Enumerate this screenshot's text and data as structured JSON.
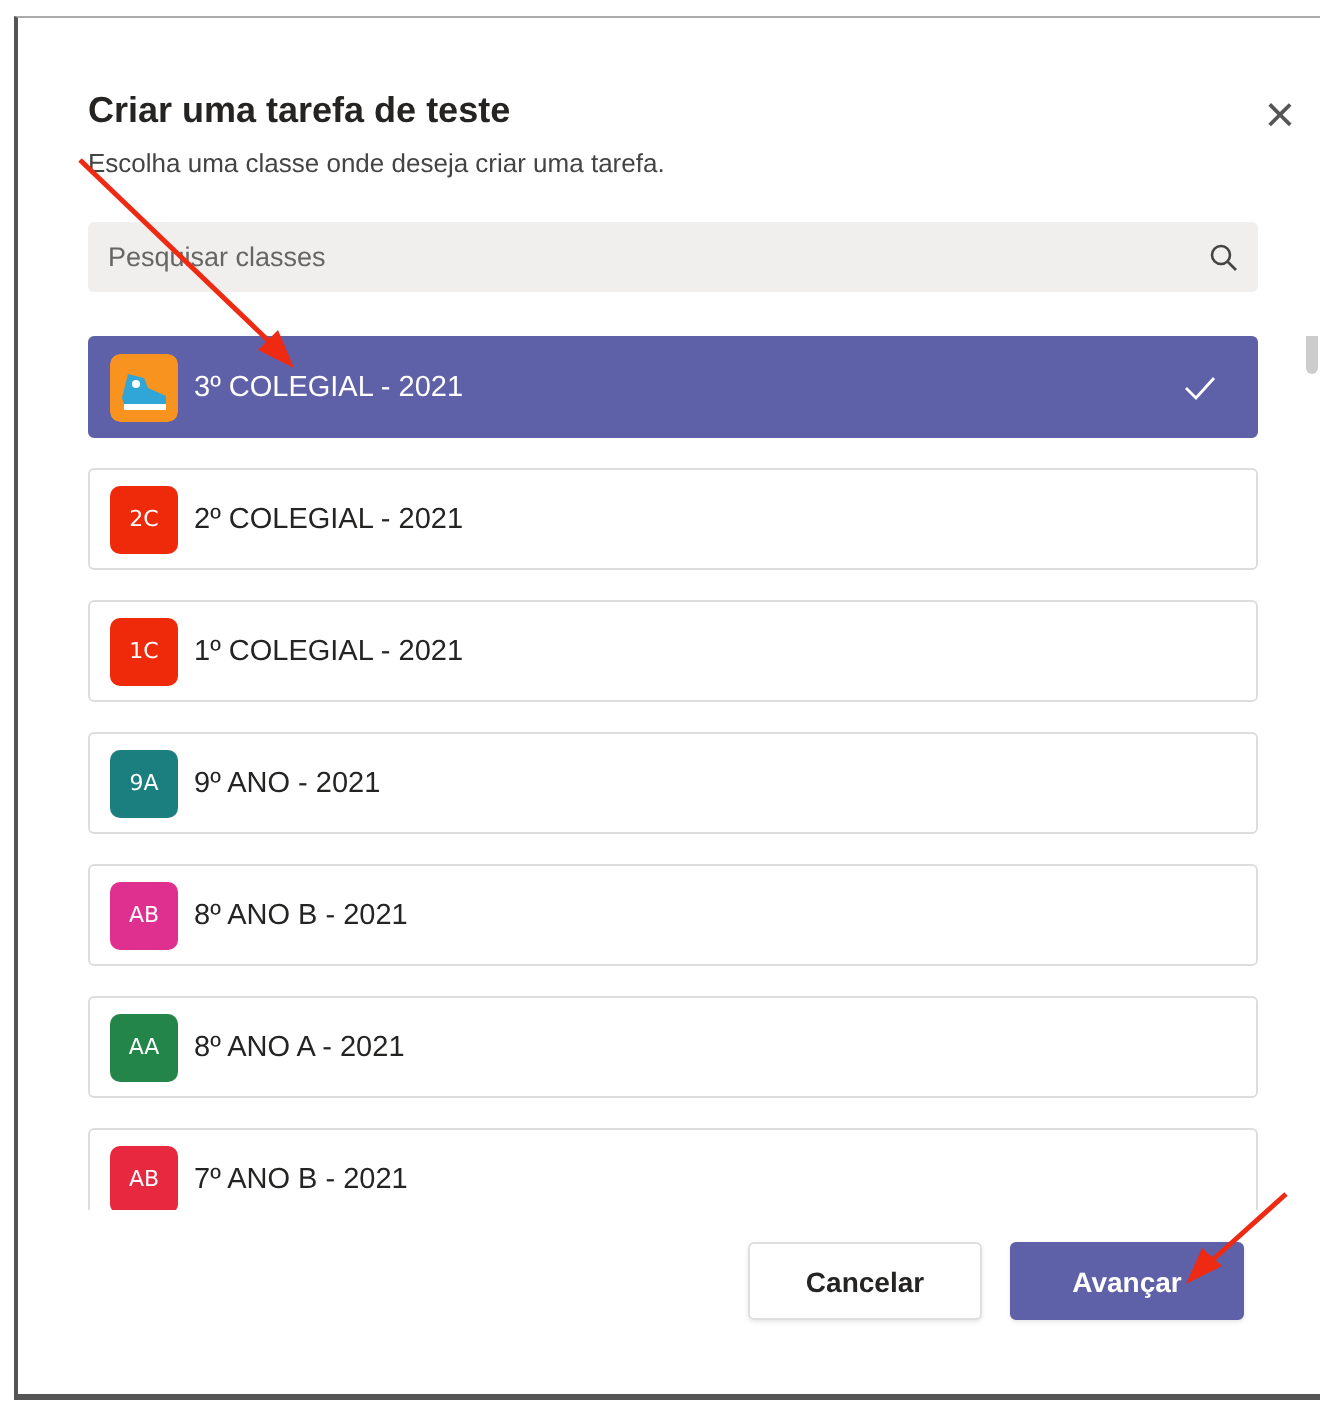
{
  "dialog": {
    "title": "Criar uma tarefa de teste",
    "subtitle": "Escolha uma classe onde deseja criar uma tarefa.",
    "close": "×"
  },
  "search": {
    "placeholder": "Pesquisar classes"
  },
  "classes": [
    {
      "name": "3º COLEGIAL - 2021",
      "kind": "picture",
      "selected": true,
      "color": "#f7931e"
    },
    {
      "name": "2º COLEGIAL - 2021",
      "kind": "initials",
      "initials": "2C",
      "selected": false,
      "color": "#ee2a0a"
    },
    {
      "name": "1º COLEGIAL - 2021",
      "kind": "initials",
      "initials": "1C",
      "selected": false,
      "color": "#ee2a0a"
    },
    {
      "name": "9º ANO - 2021",
      "kind": "initials",
      "initials": "9A",
      "selected": false,
      "color": "#1b7f80"
    },
    {
      "name": "8º ANO B - 2021",
      "kind": "initials",
      "initials": "AB",
      "selected": false,
      "color": "#e0308f"
    },
    {
      "name": "8º ANO A - 2021",
      "kind": "initials",
      "initials": "AA",
      "selected": false,
      "color": "#23854a"
    },
    {
      "name": "7º ANO B - 2021",
      "kind": "initials",
      "initials": "AB",
      "selected": false,
      "color": "#e8283e"
    }
  ],
  "buttons": [
    {
      "label": "Cancelar",
      "kind": "secondary"
    },
    {
      "label": "Avançar",
      "kind": "primary"
    }
  ]
}
